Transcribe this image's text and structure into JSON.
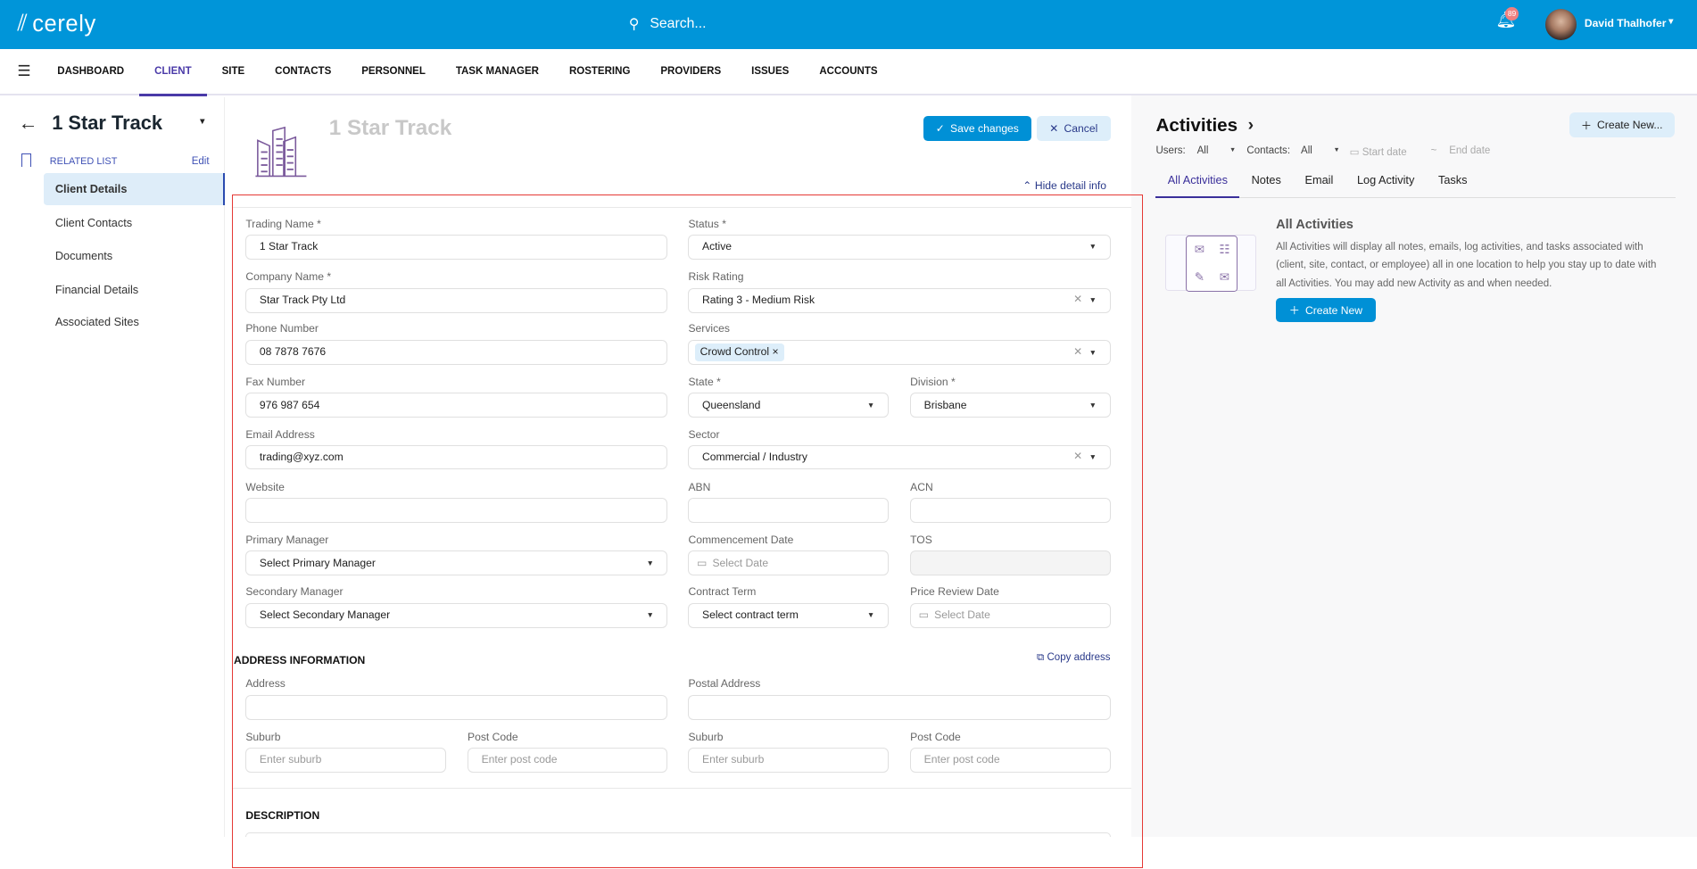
{
  "header": {
    "logo": "cerely",
    "search_placeholder": "Search...",
    "notifications": "89",
    "user": "David Thalhofer"
  },
  "nav": [
    "DASHBOARD",
    "CLIENT",
    "SITE",
    "CONTACTS",
    "PERSONNEL",
    "TASK MANAGER",
    "ROSTERING",
    "PROVIDERS",
    "ISSUES",
    "ACCOUNTS"
  ],
  "sidebar": {
    "title": "1 Star Track",
    "related": "RELATED LIST",
    "edit": "Edit",
    "items": [
      "Client Details",
      "Client Contacts",
      "Documents",
      "Financial Details",
      "Associated Sites"
    ]
  },
  "main": {
    "title": "1 Star Track",
    "save": "Save changes",
    "cancel": "Cancel",
    "hide": "Hide detail info",
    "fields": {
      "trading_l": "Trading Name *",
      "trading": "1 Star Track",
      "status_l": "Status *",
      "status": "Active",
      "company_l": "Company Name *",
      "company": "Star Track Pty Ltd",
      "risk_l": "Risk Rating",
      "risk": "Rating 3 - Medium Risk",
      "phone_l": "Phone Number",
      "phone": "08 7878 7676",
      "services_l": "Services",
      "services_tag": "Crowd Control",
      "fax_l": "Fax Number",
      "fax": "976 987 654",
      "state_l": "State *",
      "state": "Queensland",
      "division_l": "Division *",
      "division": "Brisbane",
      "email_l": "Email Address",
      "email": "trading@xyz.com",
      "sector_l": "Sector",
      "sector": "Commercial / Industry",
      "website_l": "Website",
      "abn_l": "ABN",
      "acn_l": "ACN",
      "pm_l": "Primary Manager",
      "pm": "Select Primary Manager",
      "comm_l": "Commencement Date",
      "comm": "Select Date",
      "tos_l": "TOS",
      "sm_l": "Secondary Manager",
      "sm": "Select Secondary Manager",
      "ct_l": "Contract Term",
      "ct": "Select contract term",
      "prd_l": "Price Review Date",
      "prd": "Select Date"
    },
    "address": {
      "heading": "ADDRESS INFORMATION",
      "copy": "Copy address",
      "address_l": "Address",
      "postal_l": "Postal Address",
      "suburb_l": "Suburb",
      "suburb_ph": "Enter suburb",
      "post_l": "Post Code",
      "post_ph": "Enter post code"
    },
    "description": "DESCRIPTION"
  },
  "activities": {
    "title": "Activities",
    "create_new": "Create New...",
    "users_l": "Users:",
    "users": "All",
    "contacts_l": "Contacts:",
    "contacts": "All",
    "start": "Start date",
    "tilde": "~",
    "end": "End date",
    "tabs": [
      "All Activities",
      "Notes",
      "Email",
      "Log Activity",
      "Tasks"
    ],
    "empty_title": "All Activities",
    "empty_desc": "All Activities will display all notes, emails, log activities, and tasks associated with (client, site, contact, or employee) all in one location to help you stay up to date with all Activities. You may add new Activity as and when needed.",
    "create_btn": "Create New"
  }
}
